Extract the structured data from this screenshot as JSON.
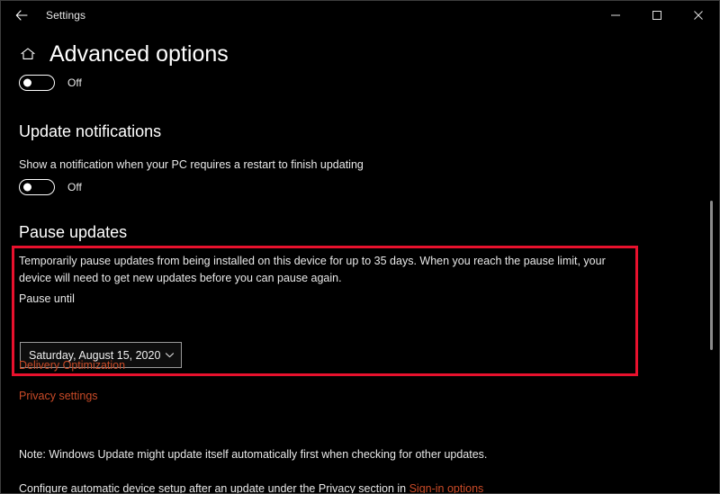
{
  "window": {
    "app_title": "Settings",
    "back_icon": "back-arrow-icon",
    "minimize_icon": "minimize-icon",
    "maximize_icon": "maximize-icon",
    "close_icon": "close-icon"
  },
  "page": {
    "home_icon": "home-icon",
    "title": "Advanced options"
  },
  "top_toggle": {
    "state_label": "Off",
    "checked": false
  },
  "update_notifications": {
    "heading": "Update notifications",
    "description": "Show a notification when your PC requires a restart to finish updating",
    "toggle": {
      "state_label": "Off",
      "checked": false
    }
  },
  "pause_updates": {
    "heading": "Pause updates",
    "description": "Temporarily pause updates from being installed on this device for up to 35 days. When you reach the pause limit, your device will need to get new updates before you can pause again.",
    "field_label": "Pause until",
    "dropdown": {
      "value": "Saturday, August 15, 2020",
      "chevron_icon": "chevron-down-icon"
    },
    "highlight_color": "#e8112d"
  },
  "links": {
    "delivery_optimization": "Delivery Optimization",
    "privacy_settings": "Privacy settings"
  },
  "notes": {
    "note_line": "Note: Windows Update might update itself automatically first when checking for other updates.",
    "configure_prefix": "Configure automatic device setup after an update under the Privacy section in ",
    "sign_in_options_link": "Sign-in options"
  },
  "colors": {
    "accent_link": "#c94a27",
    "highlight": "#e8112d",
    "background": "#000000"
  }
}
